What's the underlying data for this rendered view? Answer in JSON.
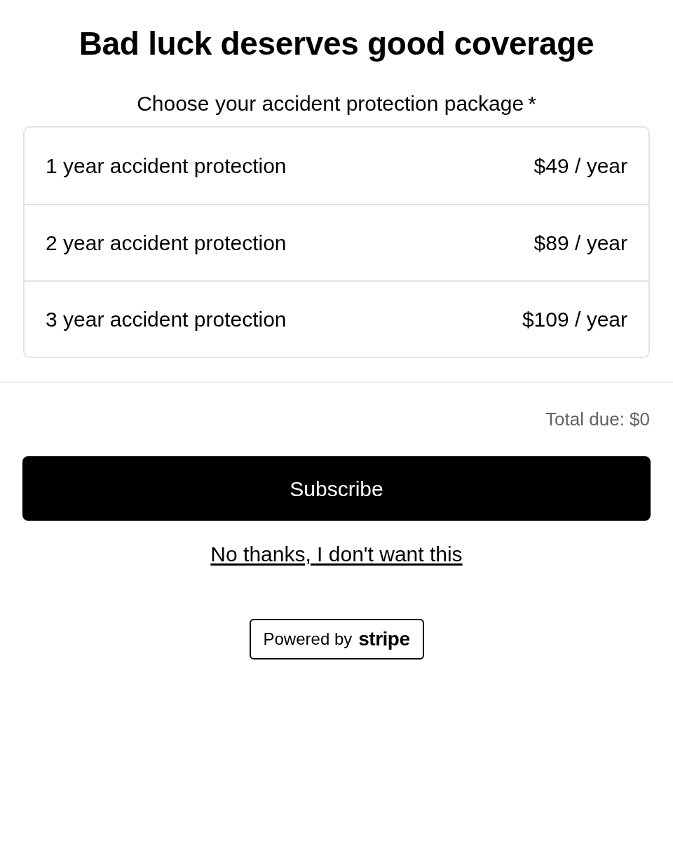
{
  "title": "Bad luck deserves good coverage",
  "package_picker": {
    "label": "Choose your accident protection package",
    "required_mark": "*",
    "options": [
      {
        "name": "1 year accident protection",
        "price": "$49 / year",
        "selected": false
      },
      {
        "name": "2 year accident protection",
        "price": "$89 / year",
        "selected": false
      },
      {
        "name": "3 year accident protection",
        "price": "$109 / year",
        "selected": false
      }
    ]
  },
  "total": "Total due: $0",
  "subscribe_button": "Subscribe",
  "decline_link": "No thanks, I don't want this",
  "badge": {
    "label": "Powered by",
    "logo": "stripe"
  }
}
